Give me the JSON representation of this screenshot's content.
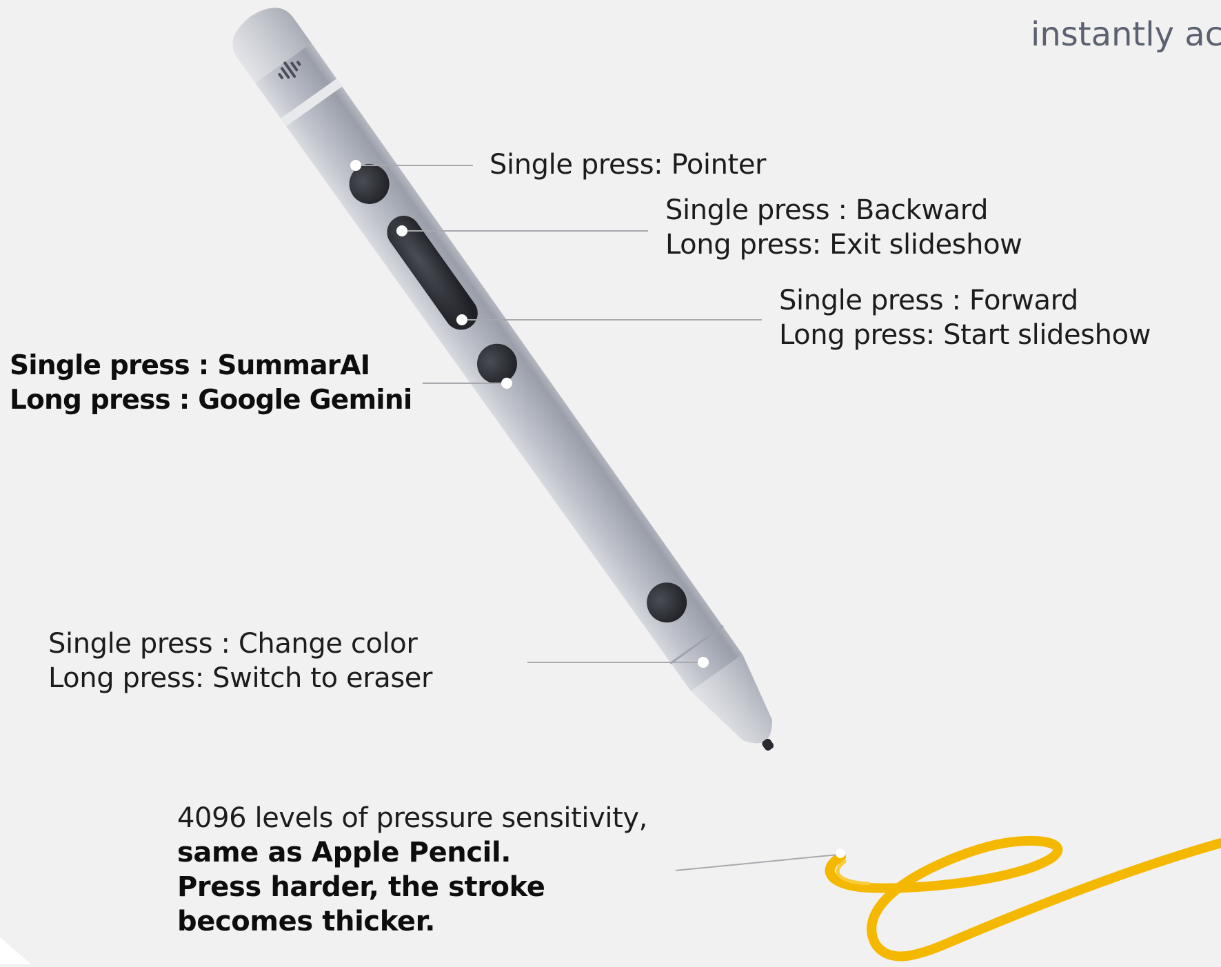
{
  "header": {
    "partial_text": "instantly ac"
  },
  "callouts": {
    "pointer": {
      "line1": "Single press: Pointer"
    },
    "backward": {
      "line1": "Single press : Backward",
      "line2": "Long press: Exit slideshow"
    },
    "forward": {
      "line1": "Single press : Forward",
      "line2": "Long press: Start slideshow"
    },
    "summarai": {
      "line1": "Single press :  SummarAI",
      "line2": "Long press : Google Gemini"
    },
    "color": {
      "line1": "Single press : Change color",
      "line2": "Long press: Switch to eraser"
    },
    "pressure": {
      "line1": "4096 levels of pressure sensitivity,",
      "line2": "same as Apple Pencil.",
      "line3": "Press harder, the stroke",
      "line4": "becomes thicker."
    }
  },
  "colors": {
    "background": "#f1f1f1",
    "pen_body": "#b9bcc5",
    "button": "#2b2d33",
    "ink_stroke": "#f5b800"
  },
  "icons": {
    "pen_logo": "audio-wave-icon"
  }
}
